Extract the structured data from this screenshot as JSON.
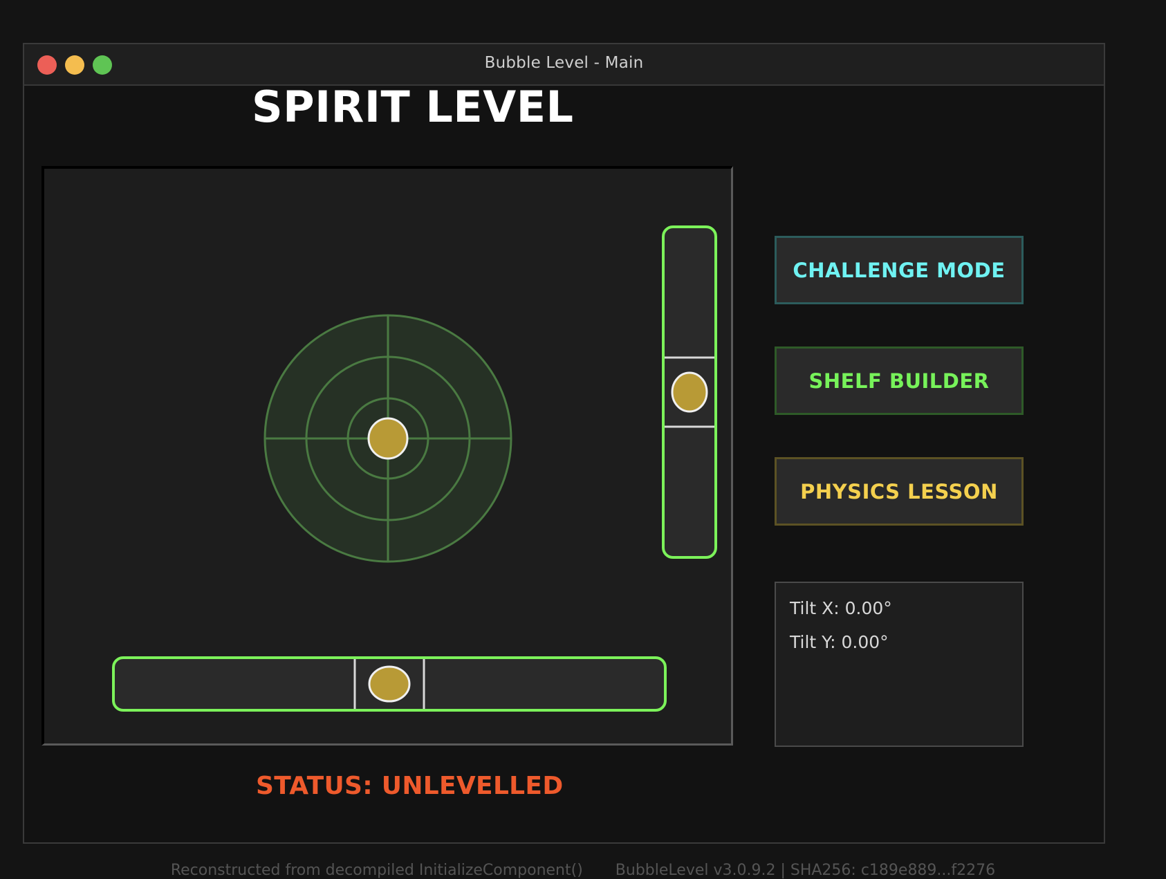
{
  "window": {
    "title": "Bubble Level - Main"
  },
  "app": {
    "title": "SPIRIT LEVEL"
  },
  "buttons": {
    "challenge": "CHALLENGE MODE",
    "shelf": "SHELF BUILDER",
    "physics": "PHYSICS LESSON"
  },
  "readout": {
    "tilt_x": "Tilt X: 0.00°",
    "tilt_y": "Tilt Y: 0.00°"
  },
  "status": {
    "text": "STATUS: UNLEVELLED"
  },
  "footer": {
    "left": "Reconstructed from decompiled InitializeComponent()",
    "right": "BubbleLevel v3.0.9.2 | SHA256: c189e889...f2276"
  },
  "colors": {
    "accent_green": "#7cf25a",
    "bubble": "#b89a36",
    "target_ring": "#4a7a42",
    "status_red": "#ee5a2c",
    "challenge_cyan": "#6ff2f2",
    "physics_yellow": "#f4d04e"
  },
  "level": {
    "tilt_x_deg": 0.0,
    "tilt_y_deg": 0.0
  }
}
